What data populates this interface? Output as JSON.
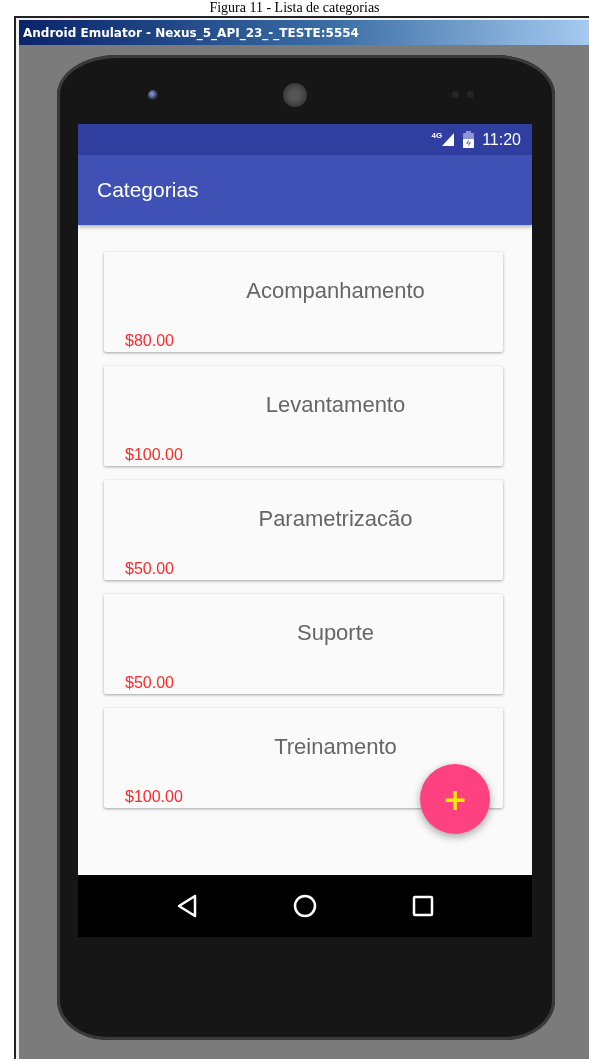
{
  "caption": "Figura 11 - Lista de categorias",
  "window": {
    "title": "Android Emulator - Nexus_5_API_23_-_TESTE:5554"
  },
  "status_bar": {
    "network": "4G",
    "time": "11:20"
  },
  "toolbar": {
    "title": "Categorias"
  },
  "categories": [
    {
      "name": "Acompanhamento",
      "price": "$80.00"
    },
    {
      "name": "Levantamento",
      "price": "$100.00"
    },
    {
      "name": "Parametrizacão",
      "price": "$50.00"
    },
    {
      "name": "Suporte",
      "price": "$50.00"
    },
    {
      "name": "Treinamento",
      "price": "$100.00"
    }
  ],
  "fab": {
    "label": "+"
  }
}
